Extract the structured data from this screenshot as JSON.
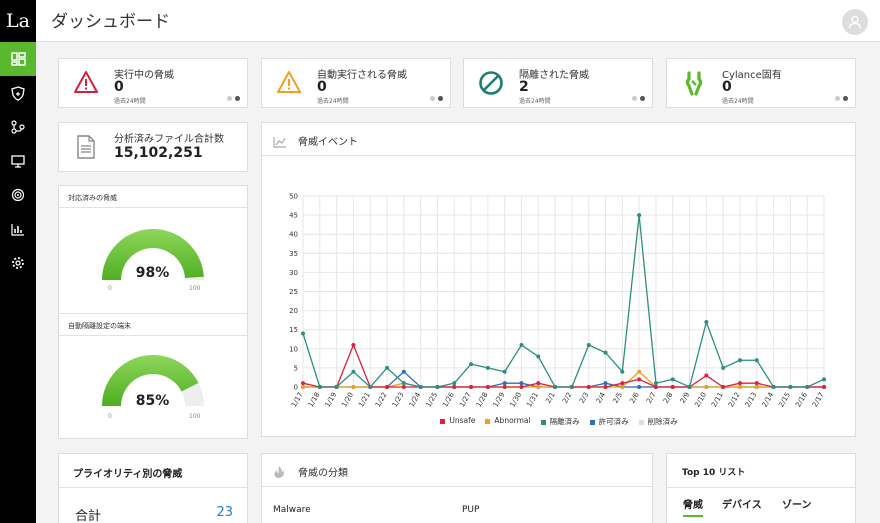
{
  "logo": "La",
  "page_title": "ダッシュボード",
  "stats": [
    {
      "label": "実行中の脅威",
      "value": "0",
      "sub": "過去24時間",
      "icon": "warning-triangle-red",
      "color": "#d6203a"
    },
    {
      "label": "自動実行される脅威",
      "value": "0",
      "sub": "過去24時間",
      "icon": "warning-triangle-orange",
      "color": "#f0a020"
    },
    {
      "label": "隔離された脅威",
      "value": "2",
      "sub": "過去24時間",
      "icon": "prohibited-circle",
      "color": "#1f7f6e"
    },
    {
      "label": "Cylance固有",
      "value": "0",
      "sub": "過去24時間",
      "icon": "cylance-bug",
      "color": "#5ab82e"
    }
  ],
  "files": {
    "label": "分析済みファイル合計数",
    "value": "15,102,251"
  },
  "gauges": [
    {
      "title": "対応済みの脅威",
      "value_text": "98%",
      "fraction": 0.98,
      "min": "0",
      "max": "100"
    },
    {
      "title": "自動隔離設定の端末",
      "value_text": "85%",
      "fraction": 0.85,
      "min": "0",
      "max": "100"
    }
  ],
  "threat_events": {
    "title": "脅威イベント"
  },
  "chart_data": {
    "type": "line",
    "title": "脅威イベント",
    "x": [
      "1/17",
      "1/18",
      "1/19",
      "1/20",
      "1/21",
      "1/22",
      "1/23",
      "1/24",
      "1/25",
      "1/26",
      "1/27",
      "1/28",
      "1/29",
      "1/30",
      "1/31",
      "2/1",
      "2/2",
      "2/3",
      "2/4",
      "2/5",
      "2/6",
      "2/7",
      "2/8",
      "2/9",
      "2/10",
      "2/11",
      "2/12",
      "2/13",
      "2/14",
      "2/15",
      "2/16",
      "2/17"
    ],
    "ylim": [
      0,
      50
    ],
    "yticks": [
      0,
      5,
      10,
      15,
      20,
      25,
      30,
      35,
      40,
      45,
      50
    ],
    "grid": true,
    "legend_position": "bottom",
    "series": [
      {
        "name": "Unsafe",
        "color": "#e0203c",
        "values": [
          1,
          0,
          0,
          11,
          0,
          0,
          0,
          0,
          0,
          0,
          0,
          0,
          0,
          0,
          1,
          0,
          0,
          0,
          0,
          1,
          2,
          0,
          0,
          0,
          3,
          0,
          1,
          1,
          0,
          0,
          0,
          0
        ]
      },
      {
        "name": "Abnormal",
        "color": "#f0a020",
        "values": [
          0,
          0,
          0,
          0,
          0,
          0,
          1,
          0,
          0,
          0,
          0,
          0,
          0,
          0,
          0,
          0,
          0,
          0,
          0,
          0,
          4,
          0,
          0,
          0,
          0,
          0,
          0,
          0,
          0,
          0,
          0,
          0
        ]
      },
      {
        "name": "隔離済み",
        "color": "#2a9080",
        "values": [
          14,
          0,
          0,
          4,
          0,
          5,
          1,
          0,
          0,
          1,
          6,
          5,
          4,
          11,
          8,
          0,
          0,
          11,
          9,
          4,
          45,
          1,
          2,
          0,
          17,
          5,
          7,
          7,
          0,
          0,
          0,
          2
        ]
      },
      {
        "name": "許可済み",
        "color": "#2f6fb5",
        "values": [
          0,
          0,
          0,
          0,
          0,
          0,
          4,
          0,
          0,
          0,
          0,
          0,
          1,
          1,
          0,
          0,
          0,
          0,
          1,
          0,
          0,
          0,
          0,
          0,
          0,
          0,
          0,
          0,
          0,
          0,
          0,
          0
        ]
      },
      {
        "name": "削除済み",
        "color": "#dddddd",
        "values": [
          0,
          0,
          0,
          0,
          0,
          0,
          0,
          0,
          0,
          0,
          0,
          0,
          0,
          0,
          0,
          0,
          0,
          0,
          0,
          0,
          0,
          0,
          0,
          0,
          0,
          0,
          0,
          0,
          0,
          0,
          0,
          0
        ]
      }
    ]
  },
  "priority": {
    "title": "プライオリティ別の脅威",
    "total_label": "合計",
    "total_value": "23"
  },
  "classification": {
    "title": "脅威の分類",
    "col1": "Malware",
    "col2": "PUP"
  },
  "top10": {
    "title": "Top 10 リスト",
    "tabs": [
      "脅威",
      "デバイス",
      "ゾーン"
    ]
  }
}
